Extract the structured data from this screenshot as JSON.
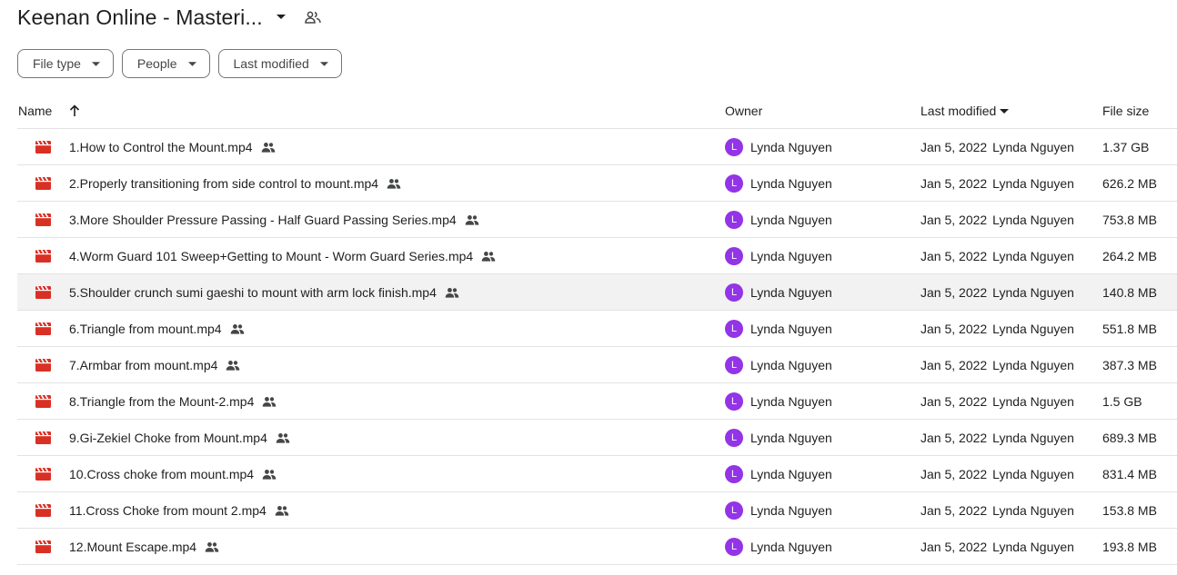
{
  "header": {
    "title": "Keenan Online - Masteri...",
    "caret_icon": "caret-down-icon",
    "shared_icon": "people-icon"
  },
  "filters": [
    {
      "label": "File type"
    },
    {
      "label": "People"
    },
    {
      "label": "Last modified"
    }
  ],
  "columns": {
    "name": "Name",
    "owner": "Owner",
    "last_modified": "Last modified",
    "file_size": "File size"
  },
  "colors": {
    "video_icon": "#d93025",
    "avatar": "#9334e6",
    "row_hover": "#f2f2f2"
  },
  "rows": [
    {
      "name": "1.How to Control the Mount.mp4",
      "owner_initial": "L",
      "owner": "Lynda Nguyen",
      "modified_date": "Jan 5, 2022",
      "modified_by": "Lynda Nguyen",
      "size": "1.37 GB"
    },
    {
      "name": "2.Properly transitioning from side control to mount.mp4",
      "owner_initial": "L",
      "owner": "Lynda Nguyen",
      "modified_date": "Jan 5, 2022",
      "modified_by": "Lynda Nguyen",
      "size": "626.2 MB"
    },
    {
      "name": "3.More Shoulder Pressure Passing - Half Guard Passing Series.mp4",
      "owner_initial": "L",
      "owner": "Lynda Nguyen",
      "modified_date": "Jan 5, 2022",
      "modified_by": "Lynda Nguyen",
      "size": "753.8 MB"
    },
    {
      "name": "4.Worm Guard 101 Sweep+Getting to Mount - Worm Guard Series.mp4",
      "owner_initial": "L",
      "owner": "Lynda Nguyen",
      "modified_date": "Jan 5, 2022",
      "modified_by": "Lynda Nguyen",
      "size": "264.2 MB"
    },
    {
      "name": "5.Shoulder crunch sumi gaeshi to mount with arm lock finish.mp4",
      "owner_initial": "L",
      "owner": "Lynda Nguyen",
      "modified_date": "Jan 5, 2022",
      "modified_by": "Lynda Nguyen",
      "size": "140.8 MB"
    },
    {
      "name": "6.Triangle from mount.mp4",
      "owner_initial": "L",
      "owner": "Lynda Nguyen",
      "modified_date": "Jan 5, 2022",
      "modified_by": "Lynda Nguyen",
      "size": "551.8 MB"
    },
    {
      "name": "7.Armbar from mount.mp4",
      "owner_initial": "L",
      "owner": "Lynda Nguyen",
      "modified_date": "Jan 5, 2022",
      "modified_by": "Lynda Nguyen",
      "size": "387.3 MB"
    },
    {
      "name": "8.Triangle from the Mount-2.mp4",
      "owner_initial": "L",
      "owner": "Lynda Nguyen",
      "modified_date": "Jan 5, 2022",
      "modified_by": "Lynda Nguyen",
      "size": "1.5 GB"
    },
    {
      "name": "9.Gi-Zekiel Choke from Mount.mp4",
      "owner_initial": "L",
      "owner": "Lynda Nguyen",
      "modified_date": "Jan 5, 2022",
      "modified_by": "Lynda Nguyen",
      "size": "689.3 MB"
    },
    {
      "name": "10.Cross choke from mount.mp4",
      "owner_initial": "L",
      "owner": "Lynda Nguyen",
      "modified_date": "Jan 5, 2022",
      "modified_by": "Lynda Nguyen",
      "size": "831.4 MB"
    },
    {
      "name": "11.Cross Choke from mount 2.mp4",
      "owner_initial": "L",
      "owner": "Lynda Nguyen",
      "modified_date": "Jan 5, 2022",
      "modified_by": "Lynda Nguyen",
      "size": "153.8 MB"
    },
    {
      "name": "12.Mount Escape.mp4",
      "owner_initial": "L",
      "owner": "Lynda Nguyen",
      "modified_date": "Jan 5, 2022",
      "modified_by": "Lynda Nguyen",
      "size": "193.8 MB"
    }
  ]
}
